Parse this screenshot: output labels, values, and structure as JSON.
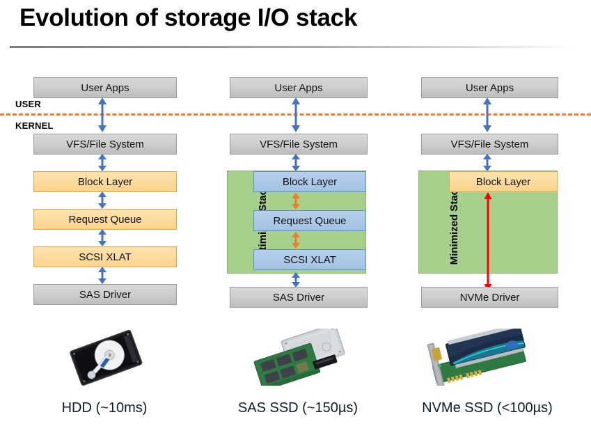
{
  "slide": {
    "title": "Evolution of storage I/O stack"
  },
  "zones": {
    "user_label": "USER",
    "kernel_label": "KERNEL",
    "divider_color": "#ed7d31"
  },
  "colors": {
    "gray_box": "#cfcfcf",
    "orange_box": "#fcd48c",
    "blue_box": "#a3c3e4",
    "green_panel": "#a8d08d",
    "blue_arrow": "#4472c4",
    "orange_arrow": "#ed7d31",
    "red_arrow": "#ff0000",
    "caption_text": "#0d1b2a"
  },
  "columns": [
    {
      "id": "hdd",
      "panel": null,
      "boxes": [
        {
          "label": "User Apps",
          "style": "gray"
        },
        {
          "label": "VFS/File System",
          "style": "gray"
        },
        {
          "label": "Block Layer",
          "style": "orange"
        },
        {
          "label": "Request Queue",
          "style": "orange"
        },
        {
          "label": "SCSI XLAT",
          "style": "orange"
        },
        {
          "label": "SAS Driver",
          "style": "gray"
        }
      ],
      "caption": "HDD (~10ms)",
      "device": "hard-disk-drive"
    },
    {
      "id": "sas-ssd",
      "panel": {
        "label": "Optimized Stack",
        "style": "green"
      },
      "boxes": [
        {
          "label": "User Apps",
          "style": "gray"
        },
        {
          "label": "VFS/File System",
          "style": "gray"
        },
        {
          "label": "Block Layer",
          "style": "blue"
        },
        {
          "label": "Request Queue",
          "style": "blue"
        },
        {
          "label": "SCSI XLAT",
          "style": "blue"
        },
        {
          "label": "SAS Driver",
          "style": "gray"
        }
      ],
      "caption": "SAS SSD (~150µs)",
      "device": "sas-ssd-board"
    },
    {
      "id": "nvme-ssd",
      "panel": {
        "label": "Minimized Stack",
        "style": "green"
      },
      "boxes": [
        {
          "label": "User Apps",
          "style": "gray"
        },
        {
          "label": "VFS/File System",
          "style": "gray"
        },
        {
          "label": "Block Layer",
          "style": "orange"
        },
        {
          "label": "NVMe Driver",
          "style": "gray"
        }
      ],
      "caption": "NVMe SSD (<100µs)",
      "device": "nvme-pcie-card"
    }
  ]
}
